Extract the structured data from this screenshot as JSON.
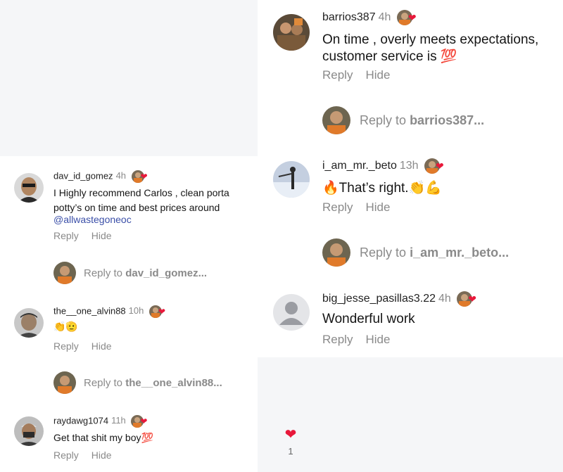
{
  "left_thread": {
    "comments": [
      {
        "username": "dav_id_gomez",
        "time": "4h",
        "text_lines": [
          "I Highly recommend Carlos , clean porta",
          "potty’s on time and best prices around"
        ],
        "mention": "@allwastegoneoc",
        "reply_label": "Reply",
        "hide_label": "Hide"
      },
      {
        "username": "the__one_alvin88",
        "time": "10h",
        "text": "👏🫡",
        "reply_label": "Reply",
        "hide_label": "Hide"
      },
      {
        "username": "raydawg1074",
        "time": "11h",
        "text": "Get that shit my boy💯",
        "reply_label": "Reply",
        "hide_label": "Hide"
      }
    ],
    "reply_prompts": [
      {
        "prefix": "Reply to",
        "target": "dav_id_gomez..."
      },
      {
        "prefix": "Reply to",
        "target": "the__one_alvin88..."
      }
    ]
  },
  "right_thread": {
    "comments": [
      {
        "username": "barrios387",
        "time": "4h",
        "text_lines": [
          "On time , overly meets expectations,",
          "customer service is 💯"
        ],
        "reply_label": "Reply",
        "hide_label": "Hide"
      },
      {
        "username": "i_am_mr._beto",
        "time": "13h",
        "text": "🔥That’s right.👏💪",
        "reply_label": "Reply",
        "hide_label": "Hide"
      },
      {
        "username": "big_jesse_pasillas3.22",
        "time": "4h",
        "text": "Wonderful work",
        "reply_label": "Reply",
        "hide_label": "Hide"
      }
    ],
    "reply_prompts": [
      {
        "prefix": "Reply to",
        "target": "barrios387..."
      },
      {
        "prefix": "Reply to",
        "target": "i_am_mr._beto..."
      }
    ]
  },
  "like": {
    "icon": "heart-icon",
    "count": "1"
  },
  "colors": {
    "heart": "#e8183a",
    "mention": "#3b4fa8",
    "muted": "#8a8a8a"
  }
}
